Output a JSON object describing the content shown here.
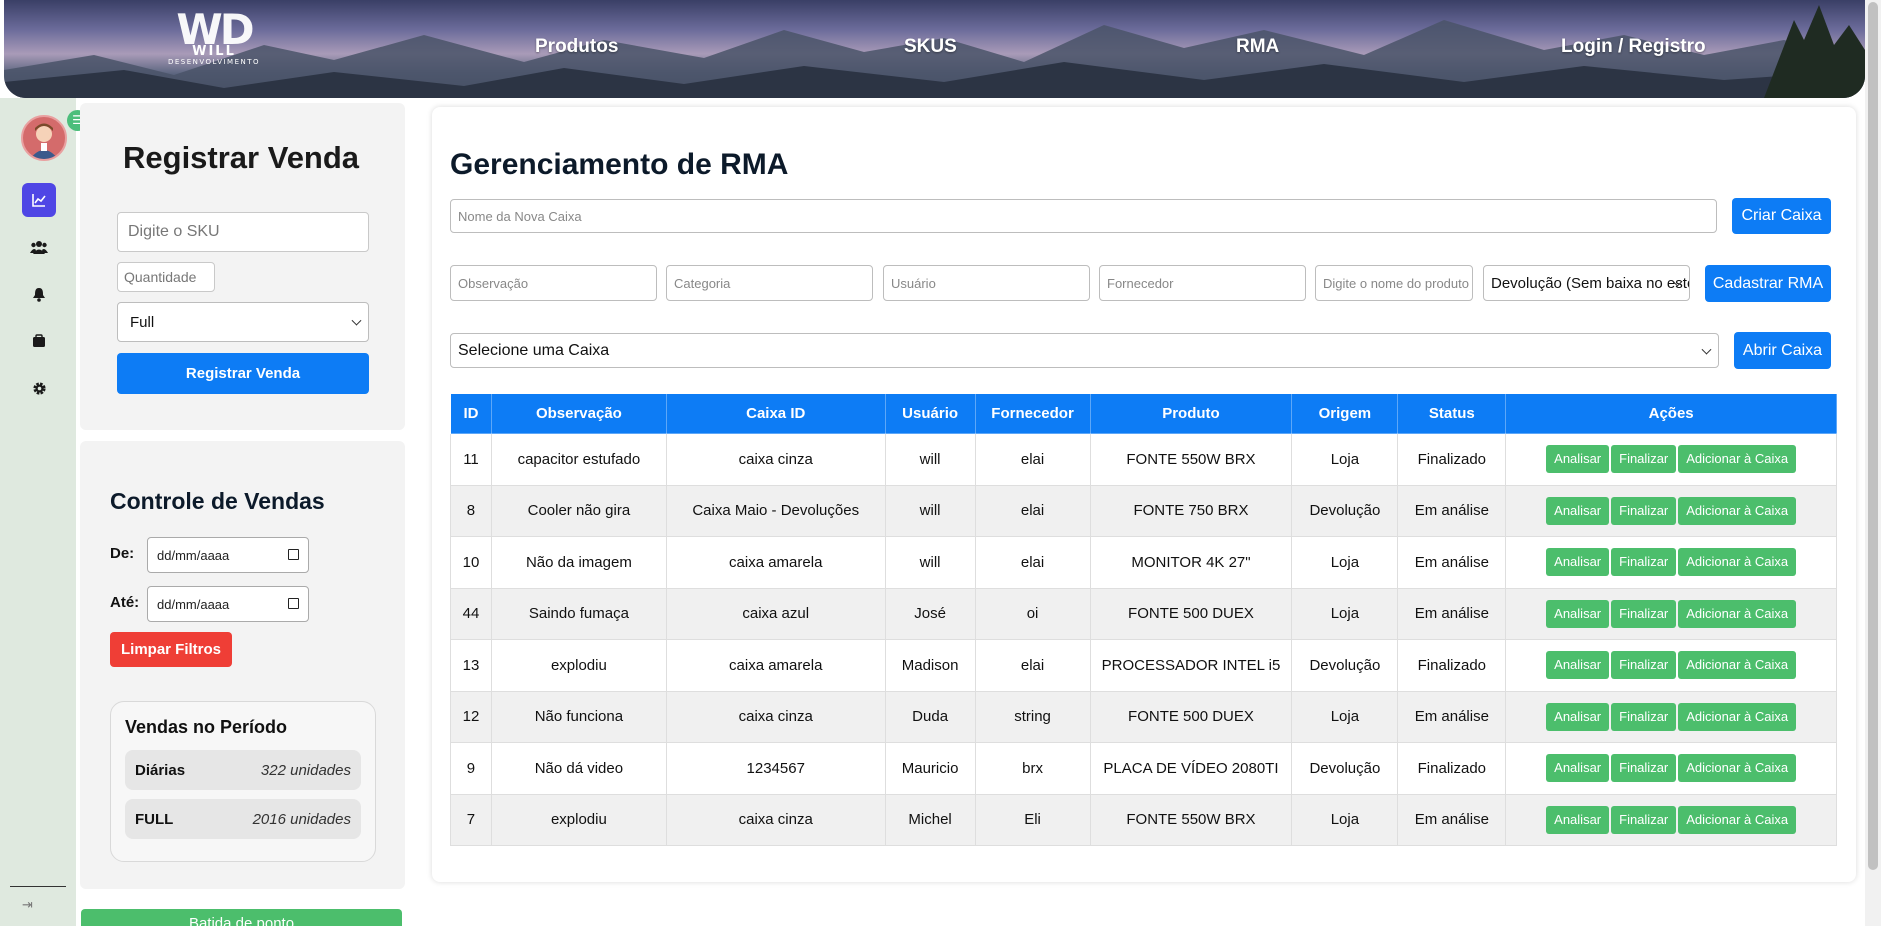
{
  "header": {
    "logo": {
      "mark": "WD",
      "name": "WILL",
      "tagline": "DESENVOLVIMENTO"
    },
    "nav": [
      "Produtos",
      "SKUS",
      "RMA",
      "Login / Registro"
    ]
  },
  "rail": {
    "icons": [
      "chart-line-icon",
      "users-icon",
      "bell-icon",
      "box-icon",
      "gear-icon"
    ],
    "accent": "#4f46e5"
  },
  "registrar": {
    "title": "Registrar Venda",
    "sku_placeholder": "Digite o SKU",
    "qty_placeholder": "Quantidade",
    "type_value": "Full",
    "button": "Registrar Venda"
  },
  "controle": {
    "title": "Controle de Vendas",
    "de_label": "De:",
    "ate_label": "Até:",
    "date_placeholder": "dd/mm/aaaa",
    "clear_button": "Limpar Filtros",
    "periodo_title": "Vendas no Período",
    "rows": [
      {
        "label": "Diárias",
        "value": "322 unidades"
      },
      {
        "label": "FULL",
        "value": "2016 unidades"
      }
    ],
    "bottom_button": "Batida de ponto"
  },
  "rma": {
    "title": "Gerenciamento de RMA",
    "new_box_placeholder": "Nome da Nova Caixa",
    "create_box_button": "Criar Caixa",
    "filters": {
      "observacao": "Observação",
      "categoria": "Categoria",
      "usuario": "Usuário",
      "fornecedor": "Fornecedor",
      "produto": "Digite o nome do produto",
      "origem": "Devolução (Sem baixa no estoque)"
    },
    "cadastrar_button": "Cadastrar RMA",
    "select_box_value": "Selecione uma Caixa",
    "open_box_button": "Abrir Caixa",
    "columns": [
      "ID",
      "Observação",
      "Caixa ID",
      "Usuário",
      "Fornecedor",
      "Produto",
      "Origem",
      "Status",
      "Ações"
    ],
    "actions": [
      "Analisar",
      "Finalizar",
      "Adicionar à Caixa"
    ],
    "rows": [
      [
        "11",
        "capacitor estufado",
        "caixa cinza",
        "will",
        "elai",
        "FONTE 550W BRX",
        "Loja",
        "Finalizado"
      ],
      [
        "8",
        "Cooler não gira",
        "Caixa Maio - Devoluções",
        "will",
        "elai",
        "FONTE 750 BRX",
        "Devolução",
        "Em análise"
      ],
      [
        "10",
        "Não da imagem",
        "caixa amarela",
        "will",
        "elai",
        "MONITOR 4K 27\"",
        "Loja",
        "Em análise"
      ],
      [
        "44",
        "Saindo fumaça",
        "caixa azul",
        "José",
        "oi",
        "FONTE 500 DUEX",
        "Loja",
        "Em análise"
      ],
      [
        "13",
        "explodiu",
        "caixa amarela",
        "Madison",
        "elai",
        "PROCESSADOR INTEL i5",
        "Devolução",
        "Finalizado"
      ],
      [
        "12",
        "Não funciona",
        "caixa cinza",
        "Duda",
        "string",
        "FONTE 500 DUEX",
        "Loja",
        "Em análise"
      ],
      [
        "9",
        "Não dá video",
        "1234567",
        "Mauricio",
        "brx",
        "PLACA DE VÍDEO 2080TI",
        "Devolução",
        "Finalizado"
      ],
      [
        "7",
        "explodiu",
        "caixa cinza",
        "Michel",
        "Eli",
        "FONTE 550W BRX",
        "Loja",
        "Em análise"
      ]
    ]
  },
  "colors": {
    "primary": "#0d7cf5",
    "success": "#4cbe6c",
    "danger": "#ef3e36"
  }
}
